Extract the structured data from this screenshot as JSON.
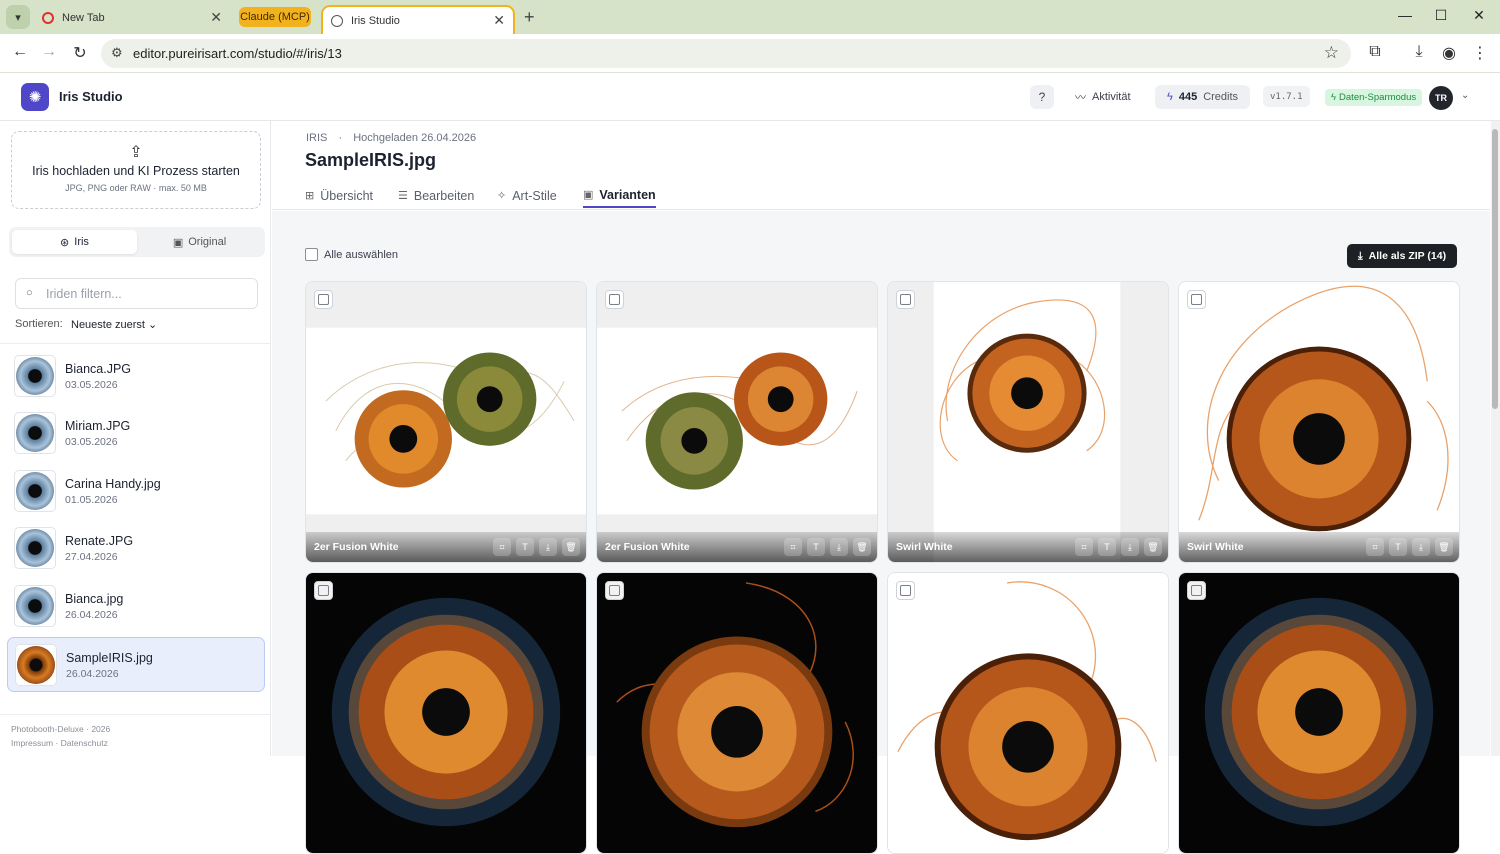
{
  "browser": {
    "tabs": [
      {
        "label": "New Tab"
      },
      {
        "label": "Claude (MCP)"
      },
      {
        "label": "Iris Studio"
      }
    ],
    "url": "editor.pureirisart.com/studio/#/iris/13"
  },
  "header": {
    "app_title": "Iris Studio",
    "activity": "Aktivität",
    "credits_value": "445",
    "credits_label": "Credits",
    "version": "v1.7.1",
    "savemode": "Daten-Sparmodus",
    "avatar": "TR"
  },
  "sidebar": {
    "upload_title": "Iris hochladen und KI Prozess starten",
    "upload_hint": "JPG, PNG oder RAW · max. 50 MB",
    "seg_iris": "Iris",
    "seg_original": "Original",
    "filter_placeholder": "Iriden filtern...",
    "sort_label": "Sortieren:",
    "sort_value": "Neueste zuerst",
    "items": [
      {
        "name": "Bianca.JPG",
        "date": "03.05.2026"
      },
      {
        "name": "Miriam.JPG",
        "date": "03.05.2026"
      },
      {
        "name": "Carina Handy.jpg",
        "date": "01.05.2026"
      },
      {
        "name": "Renate.JPG",
        "date": "27.04.2026"
      },
      {
        "name": "Bianca.jpg",
        "date": "26.04.2026"
      },
      {
        "name": "SampleIRIS.jpg",
        "date": "26.04.2026"
      }
    ],
    "footer1": "Photobooth-Deluxe · 2026",
    "footer2": "Impressum · Datenschutz"
  },
  "main": {
    "crumb1": "IRIS",
    "crumb_sep": "·",
    "crumb2": "Hochgeladen 26.04.2026",
    "title": "SampleIRIS.jpg",
    "tabs": [
      {
        "label": "Übersicht"
      },
      {
        "label": "Bearbeiten"
      },
      {
        "label": "Art-Stile"
      },
      {
        "label": "Varianten"
      }
    ],
    "select_all": "Alle auswählen",
    "zip_button": "Alle als ZIP (14)",
    "cards": [
      {
        "label": "2er Fusion White"
      },
      {
        "label": "2er Fusion White"
      },
      {
        "label": "Swirl White"
      },
      {
        "label": "Swirl White"
      },
      {
        "label": ""
      },
      {
        "label": ""
      },
      {
        "label": ""
      },
      {
        "label": ""
      }
    ]
  },
  "colors": {
    "accent": "#4f46c8",
    "tab_group": "#f2b21d",
    "savemode_bg": "#d8f5df",
    "savemode_fg": "#1f8a43"
  }
}
